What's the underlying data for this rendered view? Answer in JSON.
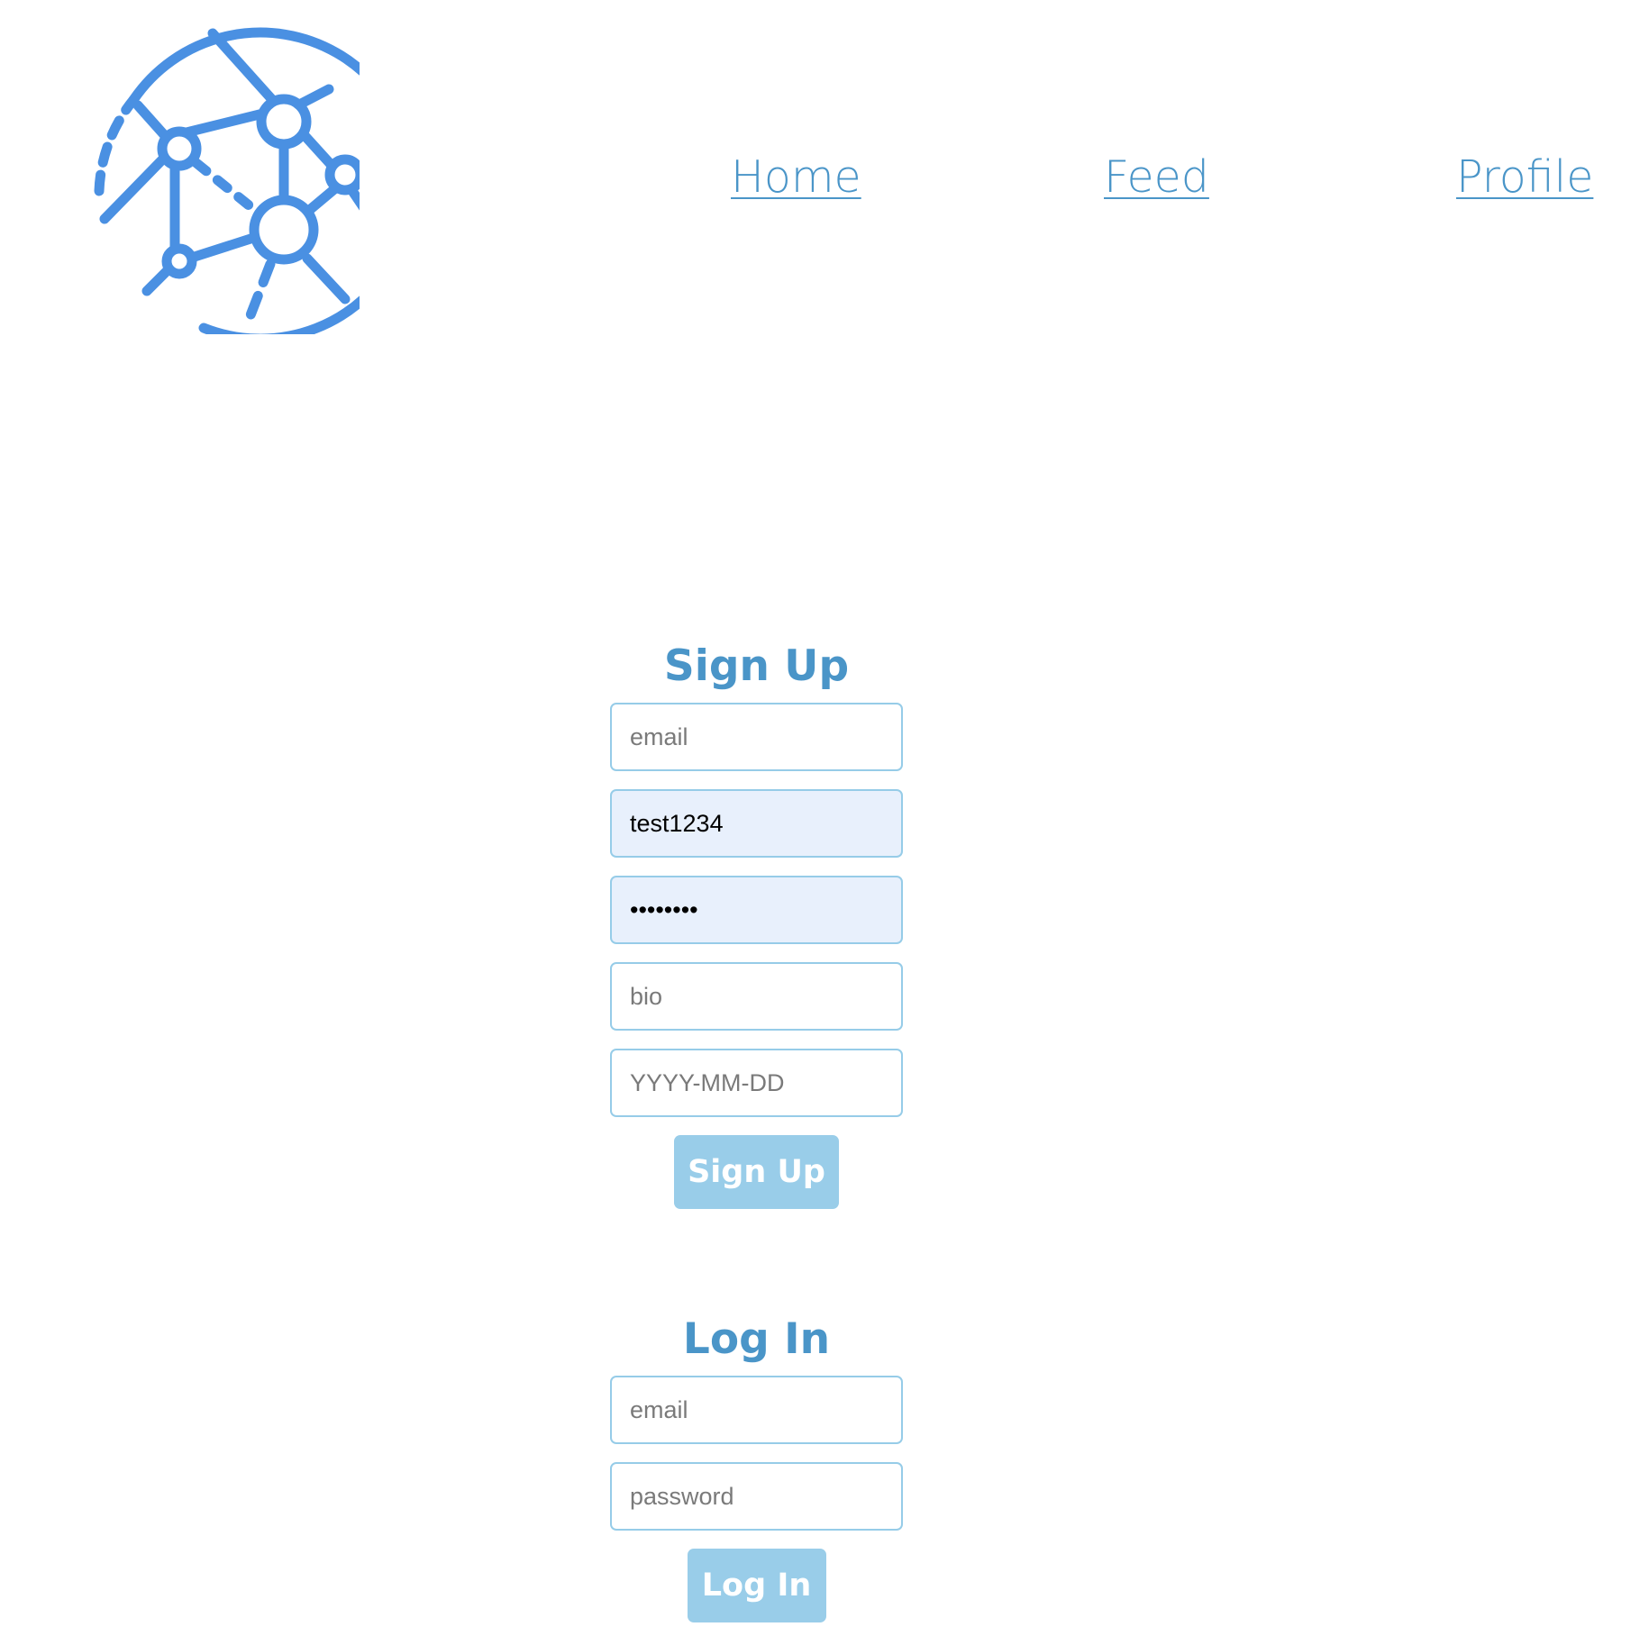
{
  "brand": {
    "logo_icon": "network-globe-icon",
    "color": "#4a90e2"
  },
  "nav": {
    "items": [
      {
        "label": "Home"
      },
      {
        "label": "Feed"
      },
      {
        "label": "Profile"
      }
    ],
    "color": "#4a95c8"
  },
  "signup": {
    "title": "Sign Up",
    "email": {
      "placeholder": "email",
      "value": ""
    },
    "username": {
      "placeholder": "",
      "value": "test1234"
    },
    "password": {
      "placeholder": "",
      "value": "12345678"
    },
    "bio": {
      "placeholder": "bio",
      "value": ""
    },
    "birthdate": {
      "placeholder": "YYYY-MM-DD",
      "value": ""
    },
    "submit_label": "Sign Up"
  },
  "login": {
    "title": "Log In",
    "email": {
      "placeholder": "email",
      "value": ""
    },
    "password": {
      "placeholder": "password",
      "value": ""
    },
    "submit_label": "Log In"
  },
  "colors": {
    "accent": "#4a95c8",
    "button_bg": "#99cde9",
    "input_border": "#96cce8",
    "autofill_bg": "#e8f0fc"
  }
}
